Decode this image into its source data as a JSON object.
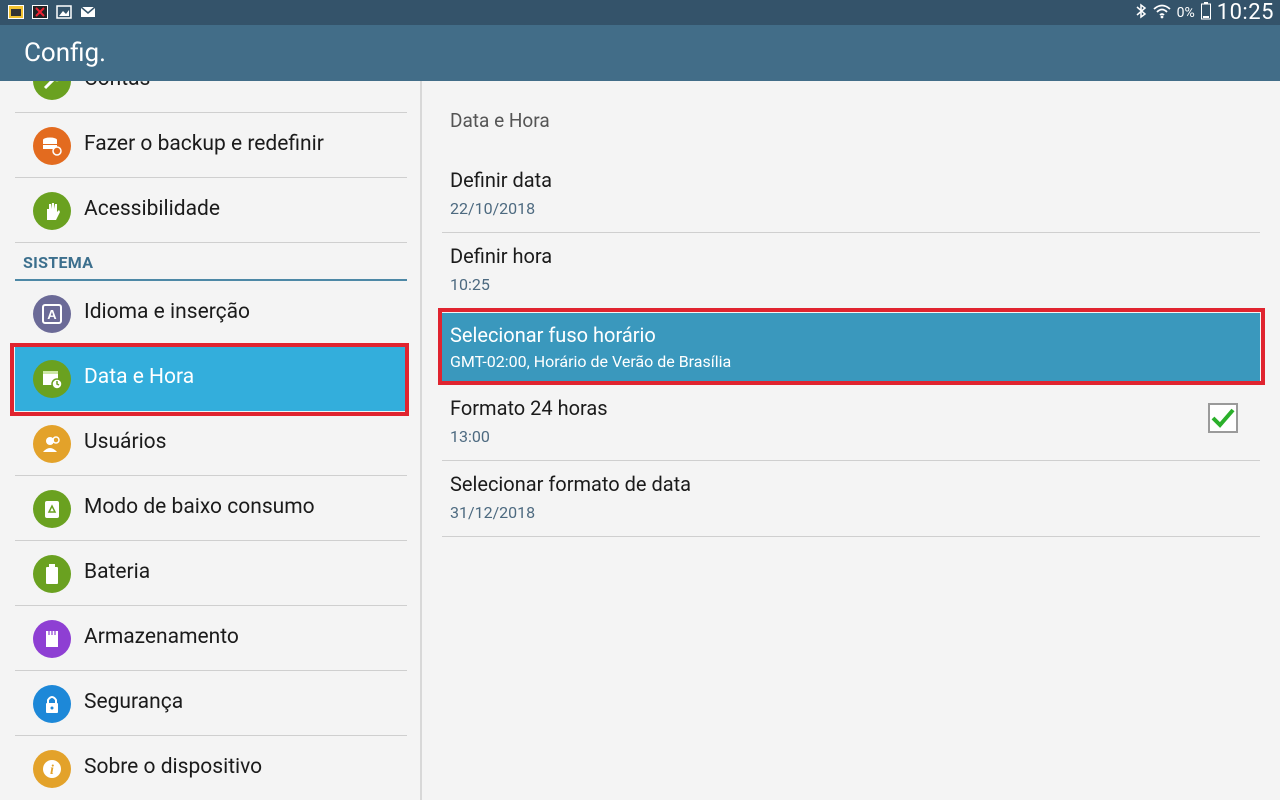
{
  "status_bar": {
    "battery_percent": "0%",
    "clock": "10:25"
  },
  "action_bar": {
    "title": "Config."
  },
  "sidebar": {
    "items_top": [
      {
        "label": "Contas",
        "icon": "key-icon",
        "color": "#6aa120"
      },
      {
        "label": "Fazer o backup e redefinir",
        "icon": "backup-icon",
        "color": "#e36b1f"
      },
      {
        "label": "Acessibilidade",
        "icon": "hand-icon",
        "color": "#6aa120"
      }
    ],
    "section_header": "SISTEMA",
    "items": [
      {
        "label": "Idioma e inserção",
        "icon": "language-icon",
        "color": "#6b6a97"
      },
      {
        "label": "Data e Hora",
        "icon": "calendar-clock-icon",
        "color": "#6aa120"
      },
      {
        "label": "Usuários",
        "icon": "users-icon",
        "color": "#e3a22a"
      },
      {
        "label": "Modo de baixo consumo",
        "icon": "recycle-icon",
        "color": "#6aa120"
      },
      {
        "label": "Bateria",
        "icon": "battery-icon",
        "color": "#6aa120"
      },
      {
        "label": "Armazenamento",
        "icon": "storage-icon",
        "color": "#8e3fd3"
      },
      {
        "label": "Segurança",
        "icon": "lock-icon",
        "color": "#1d88d8"
      },
      {
        "label": "Sobre o dispositivo",
        "icon": "info-icon",
        "color": "#e3a22a"
      }
    ],
    "selected_color": "#33aedc"
  },
  "detail": {
    "title": "Data e Hora",
    "items": [
      {
        "title": "Definir data",
        "value": "22/10/2018"
      },
      {
        "title": "Definir hora",
        "value": "10:25"
      },
      {
        "title": "Selecionar fuso horário",
        "value": "GMT-02:00, Horário de Verão de Brasília"
      },
      {
        "title": "Formato 24 horas",
        "value": "13:00",
        "checked": true
      },
      {
        "title": "Selecionar formato de data",
        "value": "31/12/2018"
      }
    ],
    "selected_color": "#3a98bd"
  },
  "highlight_color": "#e0242f"
}
